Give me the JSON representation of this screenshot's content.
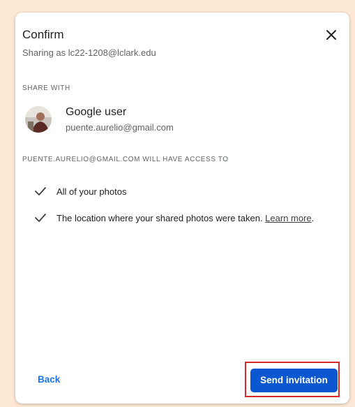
{
  "dialog": {
    "title": "Confirm",
    "subtitle": "Sharing as lc22-1208@lclark.edu",
    "close_icon": "close-icon"
  },
  "share_with": {
    "label": "SHARE WITH",
    "user": {
      "name": "Google user",
      "email": "puente.aurelio@gmail.com"
    }
  },
  "access": {
    "label": "PUENTE.AURELIO@GMAIL.COM WILL HAVE ACCESS TO",
    "items": [
      {
        "text": "All of your photos",
        "icon": "check-icon"
      },
      {
        "text": "The location where your shared photos were taken. ",
        "link": "Learn more",
        "suffix": ".",
        "icon": "check-icon"
      }
    ]
  },
  "footer": {
    "back_label": "Back",
    "send_label": "Send invitation"
  },
  "colors": {
    "page_background": "#FCE8D5",
    "primary": "#0b57d0",
    "link_blue": "#1a73e8",
    "highlight_red": "#d62a2a"
  }
}
